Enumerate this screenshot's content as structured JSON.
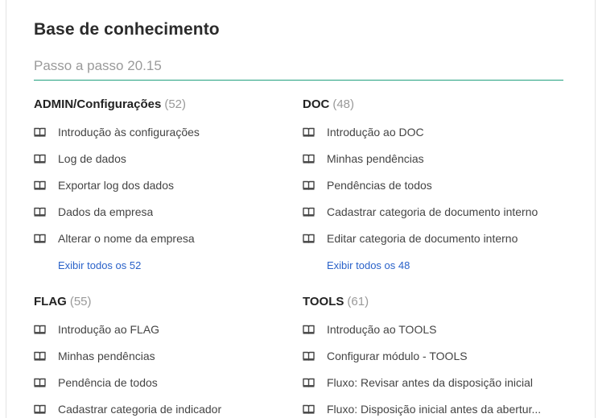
{
  "page": {
    "title": "Base de conhecimento"
  },
  "search": {
    "placeholder": "Passo a passo 20.15",
    "value": ""
  },
  "categories": [
    {
      "name": "ADMIN/Configurações",
      "count": "(52)",
      "articles": [
        "Introdução às configurações",
        "Log de dados",
        "Exportar log dos dados",
        "Dados da empresa",
        "Alterar o nome da empresa"
      ],
      "see_all": "Exibir todos os 52"
    },
    {
      "name": "DOC",
      "count": "(48)",
      "articles": [
        "Introdução ao DOC",
        "Minhas pendências",
        "Pendências de todos",
        "Cadastrar categoria de documento interno",
        "Editar categoria de documento interno"
      ],
      "see_all": "Exibir todos os 48"
    },
    {
      "name": "FLAG",
      "count": "(55)",
      "articles": [
        "Introdução ao FLAG",
        "Minhas pendências",
        "Pendência de todos",
        "Cadastrar categoria de indicador"
      ]
    },
    {
      "name": "TOOLS",
      "count": "(61)",
      "articles": [
        "Introdução ao TOOLS",
        "Configurar módulo - TOOLS",
        "Fluxo: Revisar antes da disposição inicial",
        "Fluxo: Disposição inicial antes da abertur..."
      ]
    }
  ],
  "icons": {
    "article": "book-icon"
  },
  "colors": {
    "accent_underline": "#22a07e",
    "link": "#2a62c9",
    "count": "#999999"
  }
}
